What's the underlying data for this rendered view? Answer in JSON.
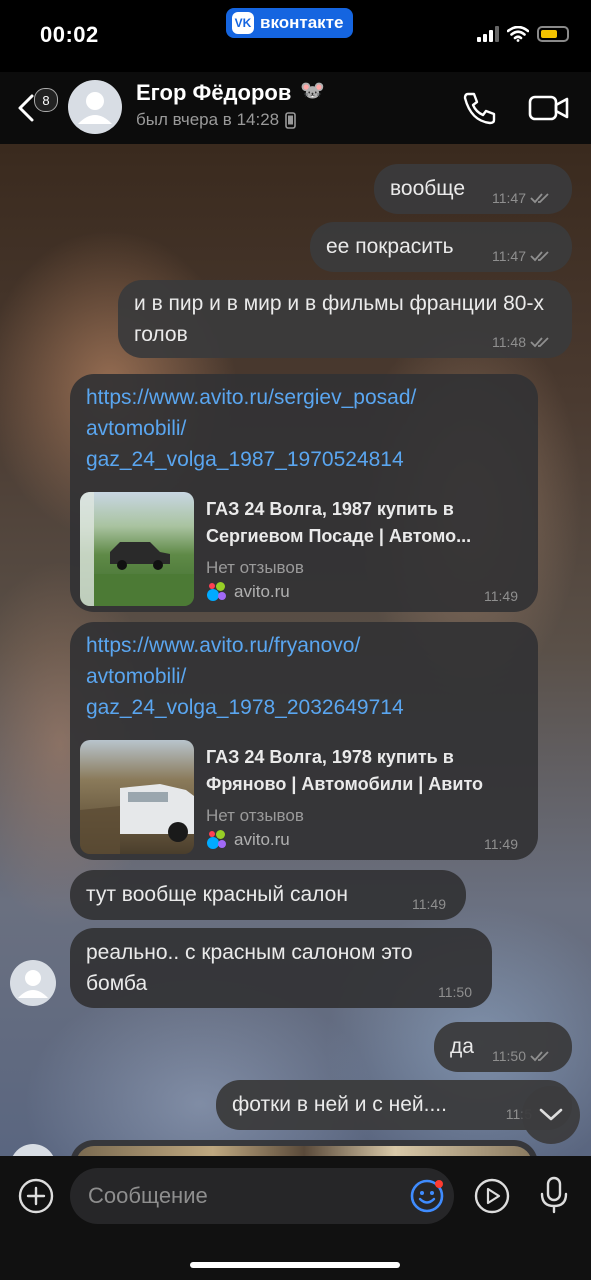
{
  "status_bar": {
    "time": "00:02",
    "app_badge": "вконтакте",
    "vk_logo_text": "VK",
    "battery_color": "#f2c200",
    "battery_level": 0.65,
    "icons": [
      "signal-icon",
      "wifi-icon",
      "battery-icon"
    ]
  },
  "header": {
    "back_badge": "8",
    "name": "Егор Фёдоров",
    "name_emoji": "🐭",
    "status": "был вчера в 14:28",
    "icons": [
      "back-icon",
      "phone-icon",
      "video-call-icon",
      "mobile-device-icon"
    ]
  },
  "messages": [
    {
      "dir": "out",
      "text": "вообще",
      "time": "11:47",
      "read": true
    },
    {
      "dir": "out",
      "text": "ее покрасить",
      "time": "11:47",
      "read": true
    },
    {
      "dir": "out",
      "text": "и в пир и в мир и в фильмы франции 80-х голов",
      "time": "11:48",
      "read": true
    },
    {
      "dir": "in",
      "link": "https://www.avito.ru/sergiev_posad/avtomobili/gaz_24_volga_1987_1970524814",
      "link_lines": [
        "https://www.avito.ru/sergiev_posad/",
        "avtomobili/",
        "gaz_24_volga_1987_1970524814"
      ],
      "preview": {
        "title": "ГАЗ 24 Волга, 1987 купить в Сергиевом Посаде | Автомо...",
        "subtitle": "Нет отзывов",
        "domain": "avito.ru"
      },
      "time": "11:49"
    },
    {
      "dir": "in",
      "link": "https://www.avito.ru/fryanovo/avtomobili/gaz_24_volga_1978_2032649714",
      "link_lines": [
        "https://www.avito.ru/fryanovo/",
        "avtomobili/",
        "gaz_24_volga_1978_2032649714"
      ],
      "preview": {
        "title": "ГАЗ 24 Волга, 1978 купить в Фряново | Автомобили | Авито",
        "subtitle": "Нет отзывов",
        "domain": "avito.ru"
      },
      "time": "11:49"
    },
    {
      "dir": "in",
      "text": "тут вообще красный салон",
      "time": "11:49"
    },
    {
      "dir": "in",
      "text": "реально.. с красным салоном это бомба",
      "time": "11:50"
    },
    {
      "dir": "out",
      "text": "да",
      "time": "11:50",
      "read": true
    },
    {
      "dir": "out",
      "text": "фотки в ней и с ней....",
      "time": "11:5"
    }
  ],
  "composer": {
    "placeholder": "Сообщение",
    "icons": [
      "plus-icon",
      "emoji-icon",
      "video-message-icon",
      "mic-icon"
    ]
  },
  "colors": {
    "link": "#5aa6f0",
    "vk_blue": "#1565e0",
    "bubble": "#323234",
    "time_text": "#8f8f8f"
  }
}
